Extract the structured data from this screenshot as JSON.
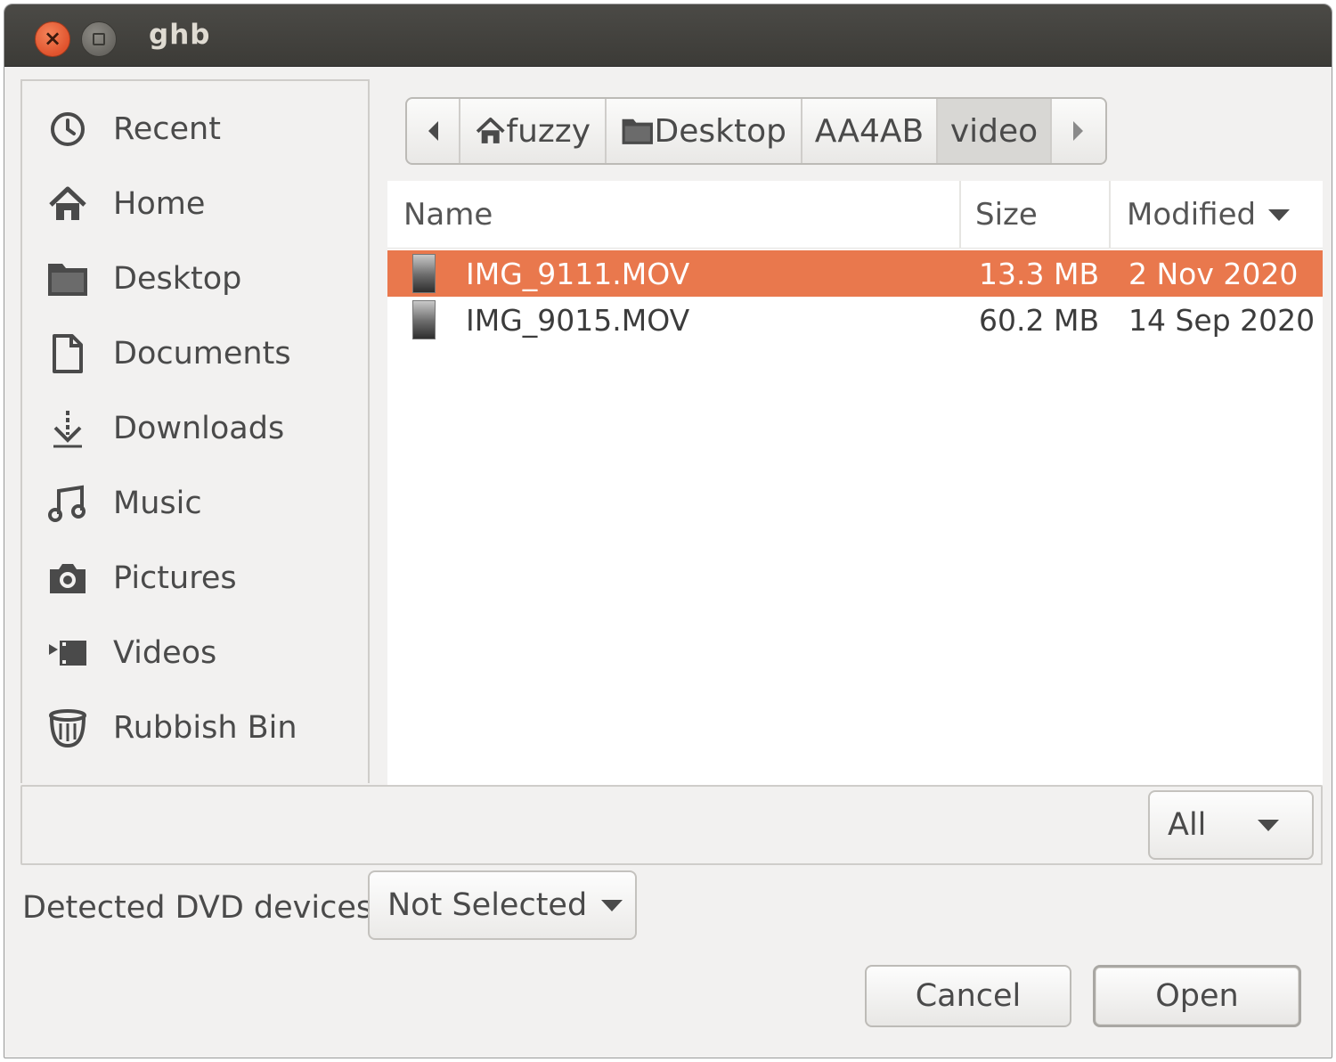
{
  "window": {
    "title": "ghb",
    "close_glyph": "×"
  },
  "sidebar": {
    "items": [
      {
        "label": "Recent",
        "icon": "clock-icon"
      },
      {
        "label": "Home",
        "icon": "home-icon"
      },
      {
        "label": "Desktop",
        "icon": "folder-icon"
      },
      {
        "label": "Documents",
        "icon": "document-icon"
      },
      {
        "label": "Downloads",
        "icon": "download-icon"
      },
      {
        "label": "Music",
        "icon": "music-icon"
      },
      {
        "label": "Pictures",
        "icon": "camera-icon"
      },
      {
        "label": "Videos",
        "icon": "video-icon"
      },
      {
        "label": "Rubbish Bin",
        "icon": "trash-icon"
      }
    ]
  },
  "pathbar": {
    "segments": [
      {
        "label": "fuzzy",
        "icon": "home-icon"
      },
      {
        "label": "Desktop",
        "icon": "folder-icon"
      },
      {
        "label": "AA4AB",
        "icon": ""
      },
      {
        "label": "video",
        "icon": "",
        "active": true
      }
    ]
  },
  "filelist": {
    "columns": {
      "name": "Name",
      "size": "Size",
      "modified": "Modified"
    },
    "sort_column": "Modified",
    "rows": [
      {
        "name": "IMG_9111.MOV",
        "size": "13.3 MB",
        "modified": "2 Nov 2020",
        "selected": true
      },
      {
        "name": "IMG_9015.MOV",
        "size": "60.2 MB",
        "modified": "14 Sep 2020",
        "selected": false
      }
    ]
  },
  "filter": {
    "value": "All"
  },
  "dvd": {
    "label": "Detected DVD devices:",
    "value": "Not Selected"
  },
  "buttons": {
    "cancel": "Cancel",
    "open": "Open"
  },
  "colors": {
    "selection": "#e9784d",
    "titlebar": "#3c3b37",
    "close_button": "#e0532d"
  }
}
